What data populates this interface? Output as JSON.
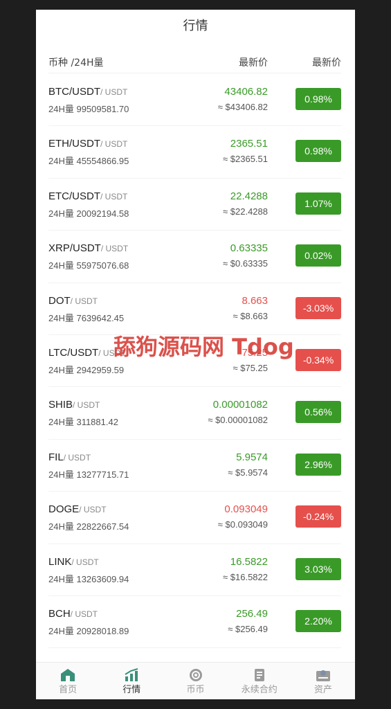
{
  "page_title": "行情",
  "header": {
    "col_pair": "币种 /24H量",
    "col_price": "最新价",
    "col_change": "最新价"
  },
  "colors": {
    "up": "#3a9a28",
    "down": "#e5504c",
    "tab_active": "#3a8f7a"
  },
  "markets": [
    {
      "base": "BTC/USDT",
      "quote": "/ USDT",
      "volume": "24H量 99509581.70",
      "price": "43406.82",
      "converted": "≈ $43406.82",
      "change": "0.98%",
      "dir": "up"
    },
    {
      "base": "ETH/USDT",
      "quote": "/ USDT",
      "volume": "24H量 45554866.95",
      "price": "2365.51",
      "converted": "≈ $2365.51",
      "change": "0.98%",
      "dir": "up"
    },
    {
      "base": "ETC/USDT",
      "quote": "/ USDT",
      "volume": "24H量 20092194.58",
      "price": "22.4288",
      "converted": "≈ $22.4288",
      "change": "1.07%",
      "dir": "up"
    },
    {
      "base": "XRP/USDT",
      "quote": "/ USDT",
      "volume": "24H量 55975076.68",
      "price": "0.63335",
      "converted": "≈ $0.63335",
      "change": "0.02%",
      "dir": "up"
    },
    {
      "base": "DOT",
      "quote": "/ USDT",
      "volume": "24H量 7639642.45",
      "price": "8.663",
      "converted": "≈ $8.663",
      "change": "-3.03%",
      "dir": "down"
    },
    {
      "base": "LTC/USDT",
      "quote": "/ USDT",
      "volume": "24H量 2942959.59",
      "price": "75.25",
      "converted": "≈ $75.25",
      "change": "-0.34%",
      "dir": "down"
    },
    {
      "base": "SHIB",
      "quote": "/ USDT",
      "volume": "24H量 311881.42",
      "price": "0.00001082",
      "converted": "≈ $0.00001082",
      "change": "0.56%",
      "dir": "up"
    },
    {
      "base": "FIL",
      "quote": "/ USDT",
      "volume": "24H量 13277715.71",
      "price": "5.9574",
      "converted": "≈ $5.9574",
      "change": "2.96%",
      "dir": "up"
    },
    {
      "base": "DOGE",
      "quote": "/ USDT",
      "volume": "24H量 22822667.54",
      "price": "0.093049",
      "converted": "≈ $0.093049",
      "change": "-0.24%",
      "dir": "down"
    },
    {
      "base": "LINK",
      "quote": "/ USDT",
      "volume": "24H量 13263609.94",
      "price": "16.5822",
      "converted": "≈ $16.5822",
      "change": "3.03%",
      "dir": "up"
    },
    {
      "base": "BCH",
      "quote": "/ USDT",
      "volume": "24H量 20928018.89",
      "price": "256.49",
      "converted": "≈ $256.49",
      "change": "2.20%",
      "dir": "up"
    }
  ],
  "watermark": "舔狗源码网 Tdog",
  "tabs": [
    {
      "label": "首页",
      "icon": "home-icon"
    },
    {
      "label": "行情",
      "icon": "chart-icon"
    },
    {
      "label": "币币",
      "icon": "coin-icon"
    },
    {
      "label": "永续合约",
      "icon": "contract-icon"
    },
    {
      "label": "资产",
      "icon": "wallet-icon"
    }
  ]
}
